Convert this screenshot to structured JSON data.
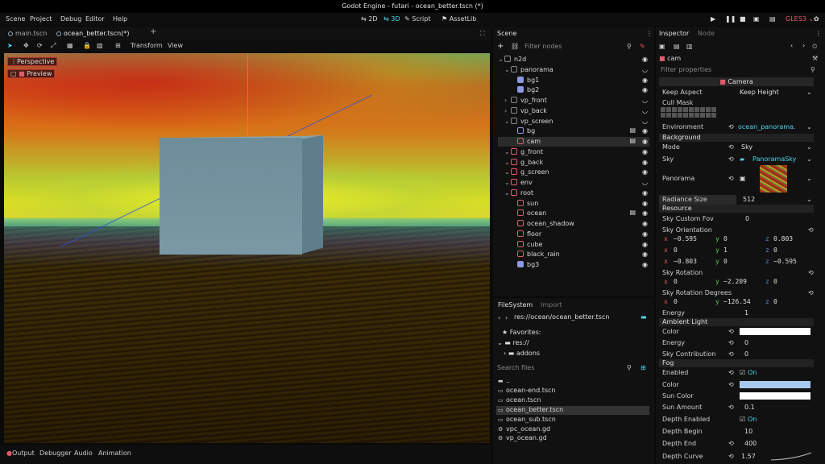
{
  "window": {
    "title": "Godot Engine - futari - ocean_better.tscn (*)"
  },
  "menu": [
    "Scene",
    "Project",
    "Debug",
    "Editor",
    "Help"
  ],
  "workspaces": [
    "2D",
    "3D",
    "Script",
    "AssetLib"
  ],
  "renderer": "GLES3",
  "editor_tabs": [
    "main.tscn",
    "ocean_better.tscn(*)"
  ],
  "toolbar": {
    "transform": "Transform",
    "view": "View"
  },
  "viewport": {
    "perspective": "Perspective",
    "preview": "Preview"
  },
  "bottom_tabs": [
    "Output",
    "Debugger",
    "Audio",
    "Animation"
  ],
  "scene_dock": {
    "title": "Scene",
    "filter_placeholder": "Filter nodes",
    "nodes": [
      {
        "name": "n2d",
        "depth": 0,
        "icon": "node2d-icon",
        "color": "#888888",
        "visible": true
      },
      {
        "name": "panorama",
        "depth": 1,
        "icon": "control-icon",
        "color": "#888888",
        "visible": false
      },
      {
        "name": "bg1",
        "depth": 2,
        "icon": "sprite-icon",
        "color": "#8a9ae0",
        "visible": true
      },
      {
        "name": "bg2",
        "depth": 2,
        "icon": "sprite-icon",
        "color": "#8a9ae0",
        "visible": true
      },
      {
        "name": "vp_front",
        "depth": 1,
        "icon": "viewport-icon",
        "color": "#888888",
        "visible": false
      },
      {
        "name": "vp_back",
        "depth": 1,
        "icon": "viewport-icon",
        "color": "#888888",
        "visible": false
      },
      {
        "name": "vp_screen",
        "depth": 1,
        "icon": "viewport-icon",
        "color": "#888888",
        "visible": false
      },
      {
        "name": "bg",
        "depth": 2,
        "icon": "mesh-icon",
        "color": "#8a9ae0",
        "visible": true,
        "script": true
      },
      {
        "name": "cam",
        "depth": 2,
        "icon": "camera-icon",
        "color": "#e05a6a",
        "visible": true,
        "script": true,
        "selected": true
      },
      {
        "name": "g_front",
        "depth": 1,
        "icon": "spatial-icon",
        "color": "#e05a6a",
        "visible": true
      },
      {
        "name": "g_back",
        "depth": 1,
        "icon": "spatial-icon",
        "color": "#e05a6a",
        "visible": true
      },
      {
        "name": "g_screen",
        "depth": 1,
        "icon": "spatial-icon",
        "color": "#e05a6a",
        "visible": true
      },
      {
        "name": "env",
        "depth": 1,
        "icon": "environment-icon",
        "color": "#e05a6a",
        "visible": false
      },
      {
        "name": "root",
        "depth": 1,
        "icon": "spatial-icon",
        "color": "#e05a6a",
        "visible": true
      },
      {
        "name": "sun",
        "depth": 2,
        "icon": "light-icon",
        "color": "#e05a6a",
        "visible": true
      },
      {
        "name": "ocean",
        "depth": 2,
        "icon": "mesh-icon",
        "color": "#e05a6a",
        "visible": true,
        "script": true
      },
      {
        "name": "ocean_shadow",
        "depth": 2,
        "icon": "mesh-icon",
        "color": "#e05a6a",
        "visible": true
      },
      {
        "name": "floor",
        "depth": 2,
        "icon": "mesh-icon",
        "color": "#e05a6a",
        "visible": true
      },
      {
        "name": "cube",
        "depth": 2,
        "icon": "mesh-icon",
        "color": "#e05a6a",
        "visible": true
      },
      {
        "name": "black_rain",
        "depth": 2,
        "icon": "particles-icon",
        "color": "#e05a6a",
        "visible": true
      },
      {
        "name": "bg3",
        "depth": 2,
        "icon": "sprite-icon",
        "color": "#8a9ae0",
        "visible": true
      }
    ]
  },
  "fs_dock": {
    "title": "FileSystem",
    "import_tab": "Import",
    "path": "res://ocean/ocean_better.tscn",
    "favorites": "Favorites:",
    "res": "res://",
    "addons": "addons",
    "search_placeholder": "Search files",
    "files": [
      "..",
      "ocean-end.tscn",
      "ocean.tscn",
      "ocean_better.tscn",
      "ocean_sub.tscn",
      "vpc_ocean.gd",
      "vp_ocean.gd"
    ]
  },
  "inspector": {
    "title": "Inspector",
    "node_tab": "Node",
    "object": "cam",
    "filter_placeholder": "Filter properties",
    "class": "Camera",
    "keep_aspect_label": "Keep Aspect",
    "keep_aspect_value": "Keep Height",
    "cull_mask": "Cull Mask",
    "environment_label": "Environment",
    "environment_value": "ocean_panorama.",
    "background_section": "Background",
    "mode_label": "Mode",
    "mode_value": "Sky",
    "sky_label": "Sky",
    "sky_value": "PanoramaSky",
    "panorama_label": "Panorama",
    "radiance_label": "Radiance Size",
    "radiance_value": "512",
    "resource_section": "Resource",
    "sky_custom_fov_label": "Sky Custom Fov",
    "sky_custom_fov_value": "0",
    "sky_orientation_label": "Sky Orientation",
    "orientation": [
      [
        "−0.595",
        "0",
        "0.803"
      ],
      [
        "0",
        "1",
        "0"
      ],
      [
        "−0.803",
        "0",
        "−0.595"
      ]
    ],
    "sky_rotation_label": "Sky Rotation",
    "sky_rotation": [
      "0",
      "−2.209",
      "0"
    ],
    "sky_rotation_deg_label": "Sky Rotation Degrees",
    "sky_rotation_deg": [
      "0",
      "−126.54",
      "0"
    ],
    "energy_label": "Energy",
    "energy_value": "1",
    "ambient_section": "Ambient Light",
    "amb_color_label": "Color",
    "amb_energy_label": "Energy",
    "amb_energy_value": "0",
    "amb_skycontrib_label": "Sky Contribution",
    "amb_skycontrib_value": "0",
    "fog_section": "Fog",
    "fog_enabled_label": "Enabled",
    "fog_enabled_value": "On",
    "fog_color_label": "Color",
    "fog_color": "#a8c8f0",
    "sun_color_label": "Sun Color",
    "sun_amount_label": "Sun Amount",
    "sun_amount_value": "0.1",
    "depth_enabled_label": "Depth Enabled",
    "depth_enabled_value": "On",
    "depth_begin_label": "Depth Begin",
    "depth_begin_value": "10",
    "depth_end_label": "Depth End",
    "depth_end_value": "400",
    "depth_curve_label": "Depth Curve",
    "depth_curve_value": "1.57"
  },
  "colors": {
    "accent": "#4dd4e8",
    "selection": "#2b2b2b",
    "node_red": "#e05a6a",
    "node_blue": "#8a9ae0"
  }
}
